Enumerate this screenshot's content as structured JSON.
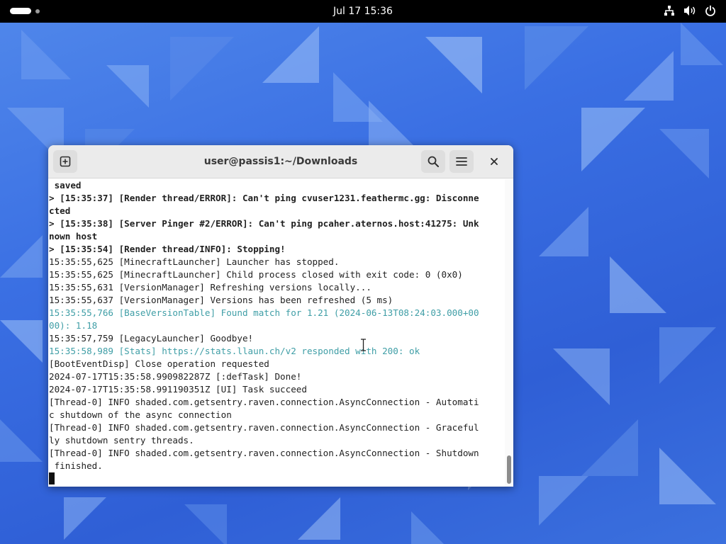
{
  "topbar": {
    "clock": "Jul 17  15:36",
    "icons": [
      "network-icon",
      "volume-icon",
      "power-icon"
    ]
  },
  "terminal": {
    "title": "user@passis1:~/Downloads",
    "buttons": {
      "new_tab": "new-tab-icon",
      "search": "search-icon",
      "menu": "hamburger-menu-icon",
      "close": "close-icon"
    },
    "lines": [
      {
        "text": " saved",
        "style": "bold"
      },
      {
        "text": "> [15:35:37] [Render thread/ERROR]: Can't ping cvuser1231.feathermc.gg: Disconne",
        "style": "bold"
      },
      {
        "text": "cted",
        "style": "bold"
      },
      {
        "text": "> [15:35:38] [Server Pinger #2/ERROR]: Can't ping pcaher.aternos.host:41275: Unk",
        "style": "bold"
      },
      {
        "text": "nown host",
        "style": "bold"
      },
      {
        "text": "> [15:35:54] [Render thread/INFO]: Stopping!",
        "style": "bold"
      },
      {
        "text": "15:35:55,625 [MinecraftLauncher] Launcher has stopped.",
        "style": "normal"
      },
      {
        "text": "15:35:55,625 [MinecraftLauncher] Child process closed with exit code: 0 (0x0)",
        "style": "normal"
      },
      {
        "text": "15:35:55,631 [VersionManager] Refreshing versions locally...",
        "style": "normal"
      },
      {
        "text": "15:35:55,637 [VersionManager] Versions has been refreshed (5 ms)",
        "style": "normal"
      },
      {
        "text": "15:35:55,766 [BaseVersionTable] Found match for 1.21 (2024-06-13T08:24:03.000+00",
        "style": "cyan"
      },
      {
        "text": "00): 1.18",
        "style": "cyan"
      },
      {
        "text": "15:35:57,759 [LegacyLauncher] Goodbye!",
        "style": "normal"
      },
      {
        "text": "15:35:58,989 [Stats] https://stats.llaun.ch/v2 responded with 200: ok",
        "style": "cyan"
      },
      {
        "text": "[BootEventDisp] Close operation requested",
        "style": "normal"
      },
      {
        "text": "2024-07-17T15:35:58.990982287Z [:defTask] Done!",
        "style": "normal"
      },
      {
        "text": "2024-07-17T15:35:58.991190351Z [UI] Task succeed",
        "style": "normal"
      },
      {
        "text": "[Thread-0] INFO shaded.com.getsentry.raven.connection.AsyncConnection - Automati",
        "style": "normal"
      },
      {
        "text": "c shutdown of the async connection",
        "style": "normal"
      },
      {
        "text": "[Thread-0] INFO shaded.com.getsentry.raven.connection.AsyncConnection - Graceful",
        "style": "normal"
      },
      {
        "text": "ly shutdown sentry threads.",
        "style": "normal"
      },
      {
        "text": "[Thread-0] INFO shaded.com.getsentry.raven.connection.AsyncConnection - Shutdown",
        "style": "normal"
      },
      {
        "text": " finished.",
        "style": "normal"
      }
    ]
  },
  "colors": {
    "topbar": "#000000",
    "wallpaper": "#3a6fe3",
    "log_cyan": "#3f9ea6",
    "headerbar": "#ebebeb"
  }
}
